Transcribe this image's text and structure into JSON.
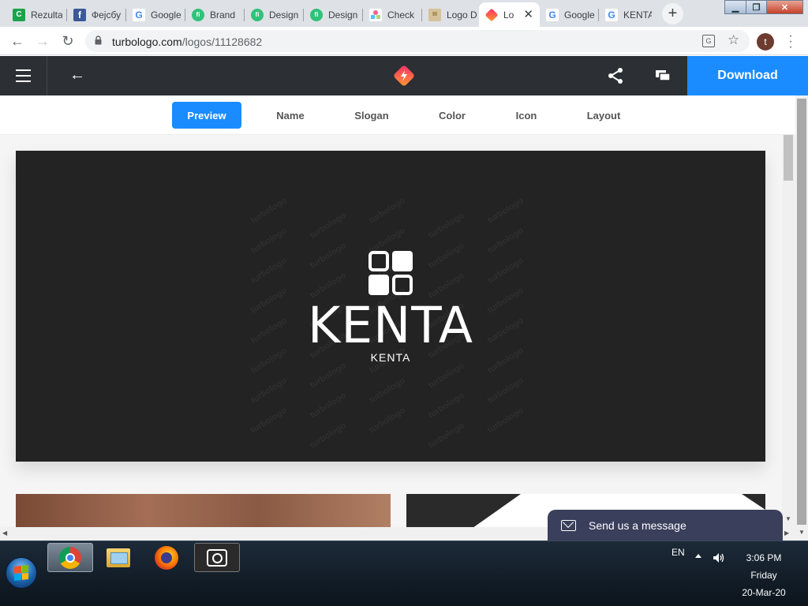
{
  "browser": {
    "tabs": [
      {
        "title": "Rezulta",
        "favicon": "rezultati-icon"
      },
      {
        "title": "Фејсбу",
        "favicon": "facebook-icon"
      },
      {
        "title": "Google",
        "favicon": "google-icon"
      },
      {
        "title": "Brand",
        "favicon": "fi-icon"
      },
      {
        "title": "Design",
        "favicon": "fi-icon"
      },
      {
        "title": "Design",
        "favicon": "fi-icon"
      },
      {
        "title": "Check",
        "favicon": "checkbox-icon"
      },
      {
        "title": "Logo D",
        "favicon": "logo-icon"
      },
      {
        "title": "Lo",
        "favicon": "turbologo-icon",
        "active": true
      },
      {
        "title": "Google",
        "favicon": "google-icon"
      },
      {
        "title": "KENTA",
        "favicon": "google-icon"
      }
    ],
    "url_host": "turbologo.com",
    "url_path": "/logos/11128682",
    "profile_initial": "t"
  },
  "site": {
    "download_label": "Download",
    "accent_color": "#1a8cff",
    "header_color": "#2c2f33"
  },
  "editor_tabs": [
    {
      "label": "Preview",
      "active": true
    },
    {
      "label": "Name"
    },
    {
      "label": "Slogan"
    },
    {
      "label": "Color"
    },
    {
      "label": "Icon"
    },
    {
      "label": "Layout"
    }
  ],
  "preview": {
    "logo_name": "KENTA",
    "logo_slogan": "KENTA",
    "watermark": "turbologo",
    "background_color": "#232323"
  },
  "chat": {
    "label": "Send us a message"
  },
  "taskbar": {
    "language": "EN",
    "time": "3:06 PM",
    "day": "Friday",
    "date": "20-Mar-20"
  }
}
